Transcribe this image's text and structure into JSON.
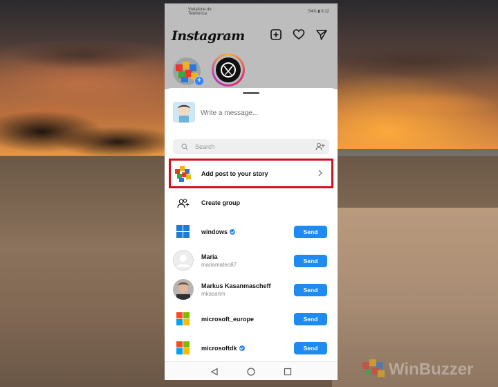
{
  "status_bar": {
    "carrier": "Vodafone.de\nTelefonica",
    "right": "54% ▮ 8:12"
  },
  "header": {
    "app_title": "Instagram",
    "icons": [
      "new-post-icon",
      "heart-icon",
      "direct-message-icon"
    ]
  },
  "stories": [
    {
      "name": "your-story",
      "has_add_badge": true
    },
    {
      "name": "xbox-story",
      "ring": true
    }
  ],
  "share_sheet": {
    "message_placeholder": "Write a message...",
    "search_placeholder": "Search",
    "add_story_label": "Add post to your story",
    "create_group_label": "Create group",
    "recipients": [
      {
        "name": "windows",
        "username": "",
        "verified": true,
        "send_label": "Send",
        "avatar": "windows-logo"
      },
      {
        "name": "Maria",
        "username": "mariamateo87",
        "verified": false,
        "send_label": "Send",
        "avatar": "default-avatar"
      },
      {
        "name": "Markus Kasanmascheff",
        "username": "mkasanm",
        "verified": false,
        "send_label": "Send",
        "avatar": "photo-avatar"
      },
      {
        "name": "microsoft_europe",
        "username": "",
        "verified": false,
        "send_label": "Send",
        "avatar": "microsoft-logo"
      },
      {
        "name": "microsoftdk",
        "username": "",
        "verified": true,
        "send_label": "Send",
        "avatar": "microsoft-logo"
      }
    ]
  },
  "nav_bar": [
    "back-icon",
    "home-icon",
    "recents-icon"
  ],
  "watermark": "WinBuzzer",
  "colors": {
    "send_button": "#1f8af0",
    "highlight_border": "#d0101c",
    "verified_badge": "#2f86f6"
  }
}
